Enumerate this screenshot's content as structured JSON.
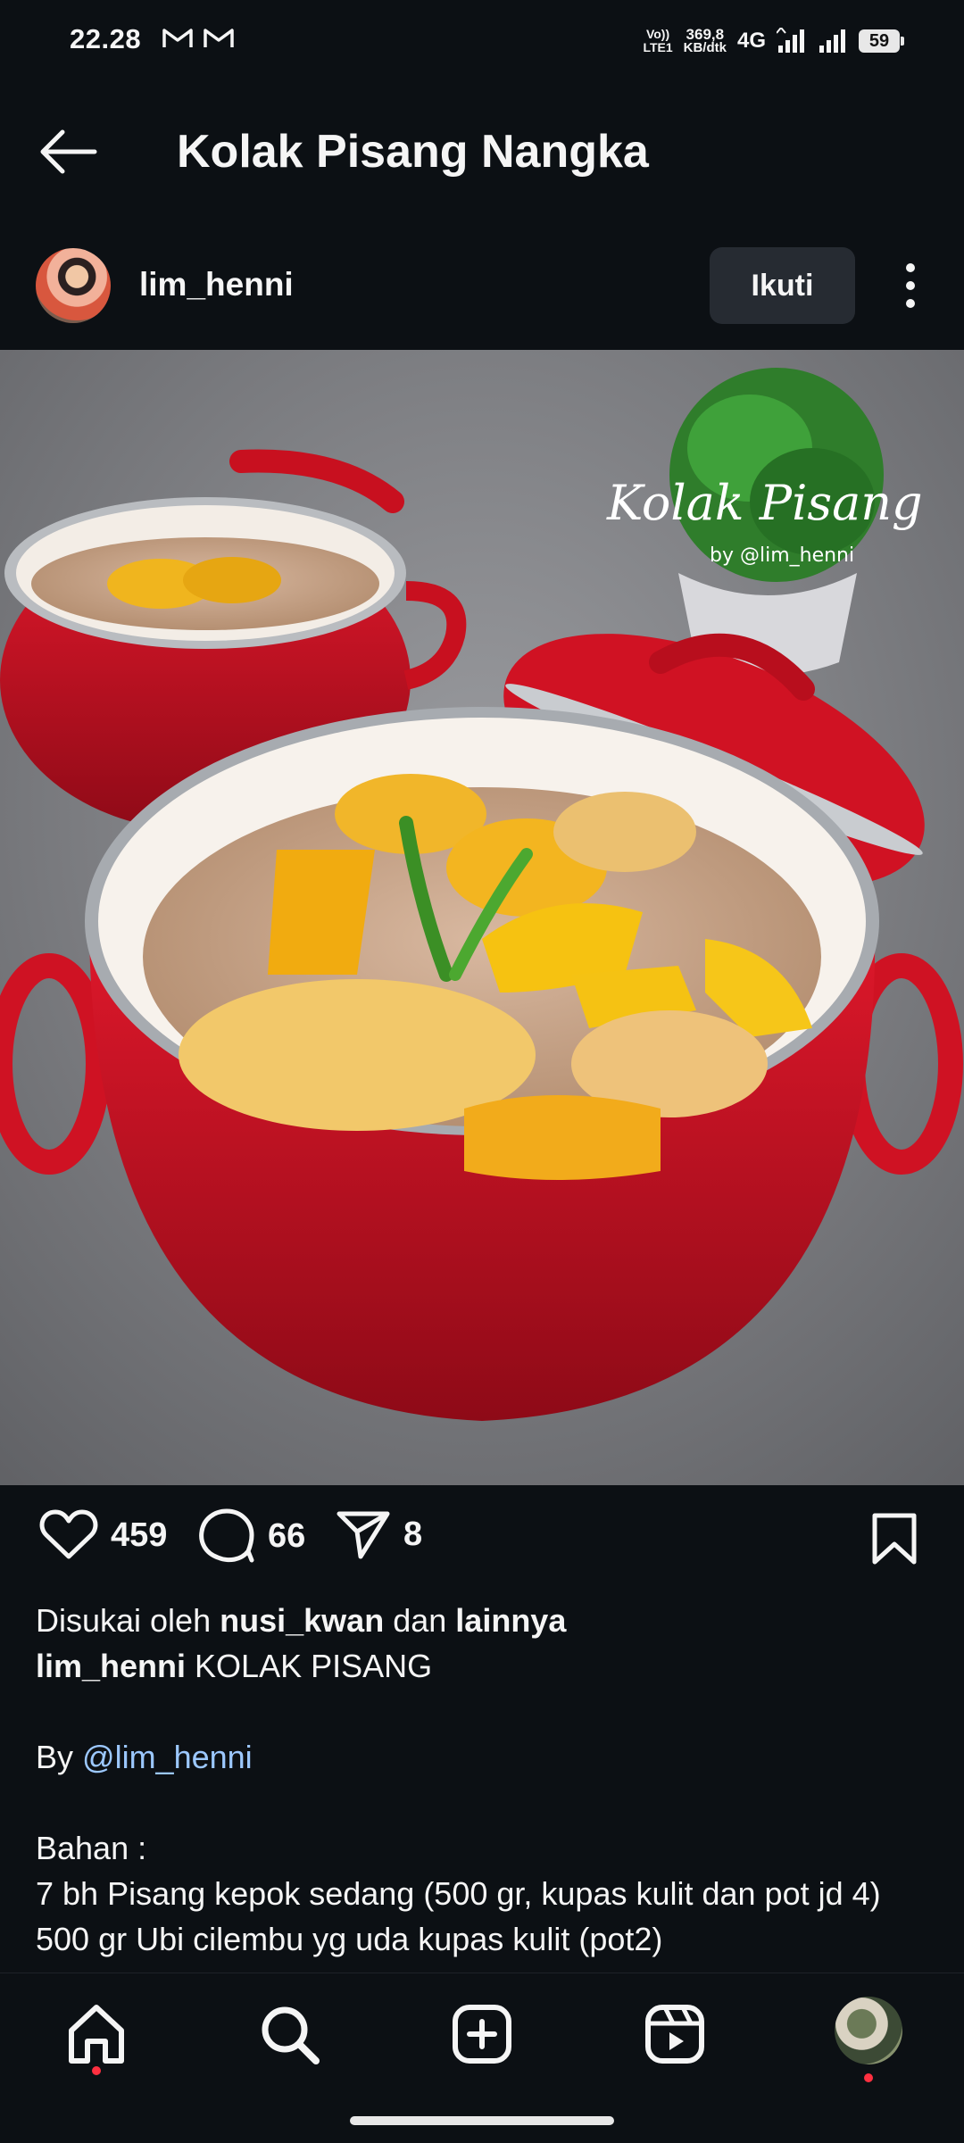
{
  "status_bar": {
    "time": "22.28",
    "volte_top": "Vo))",
    "volte_bottom": "LTE1",
    "speed_value": "369,8",
    "speed_unit": "KB/dtk",
    "network": "4G",
    "battery": "59"
  },
  "header": {
    "title": "Kolak Pisang Nangka",
    "back_icon": "arrow-left-icon"
  },
  "post": {
    "username": "lim_henni",
    "follow_label": "Ikuti",
    "photo_watermark_title": "Kolak Pisang",
    "photo_watermark_byline": "by @lim_henni",
    "likes": "459",
    "comments": "66",
    "shares": "8"
  },
  "caption": {
    "liked_prefix": "Disukai oleh",
    "liked_user": "nusi_kwan",
    "liked_and": "dan",
    "liked_others": "lainnya",
    "author": "lim_henni",
    "title_text": "KOLAK PISANG",
    "by_prefix": "By",
    "by_mention": "@lim_henni",
    "bahan_heading": "Bahan :",
    "ingredients": [
      "7 bh Pisang kepok sedang (500 gr, kupas kulit dan pot jd 4)",
      "500 gr Ubi cilembu yg uda kupas kulit (pot2)"
    ]
  },
  "bottom_nav": {
    "items": [
      "home-icon",
      "search-icon",
      "create-icon",
      "reels-icon",
      "profile-avatar"
    ]
  },
  "colors": {
    "background": "#0c1014",
    "accent_link": "#9cc8ff",
    "notification_dot": "#ff3040",
    "button_bg": "#262b32"
  }
}
